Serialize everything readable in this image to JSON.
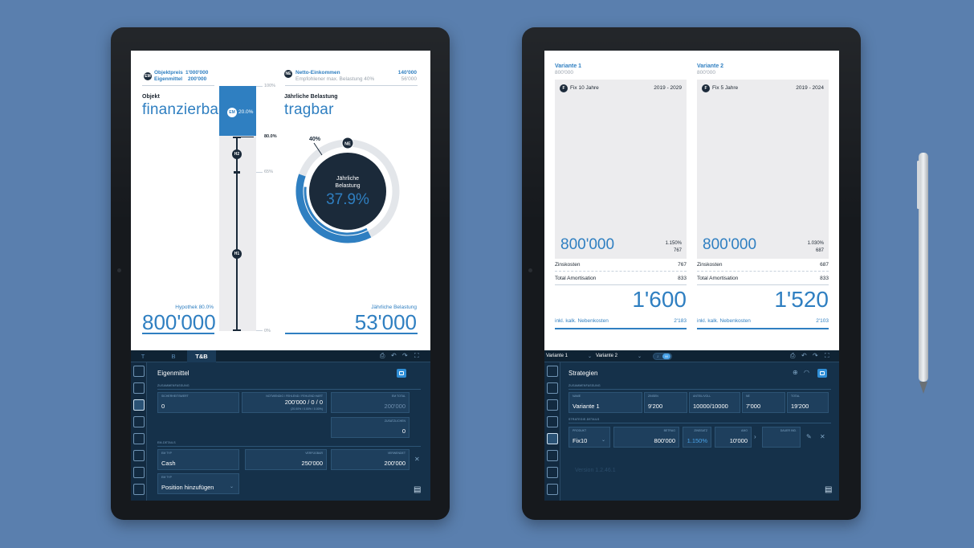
{
  "left": {
    "header": {
      "objektpreis_label": "Objektpreis",
      "objektpreis_value": "1'000'000",
      "eigenmittel_label": "Eigenmittel",
      "eigenmittel_value": "200'000",
      "em_badge": "EM",
      "ne_badge": "NE",
      "netto_label": "Netto-Einkommen",
      "netto_value": "140'000",
      "empf_label": "Empfohlener max. Belastung 40%",
      "empf_value": "56'000"
    },
    "objekt": {
      "label": "Objekt",
      "status": "finanzierbar"
    },
    "belastung": {
      "label": "Jährliche Belastung",
      "status": "tragbar"
    },
    "bar": {
      "top_pct": "100%",
      "em_pct_label": "20.0%",
      "em_badge": "EM",
      "mark_80": "80.0%",
      "mark_65": "65%",
      "bottom_pct": "0%",
      "h2": "H2",
      "h1": "H1"
    },
    "donut": {
      "pct_40": "40%",
      "ne_badge": "NE",
      "center_label_1": "Jährliche",
      "center_label_2": "Belastung",
      "center_value": "37.9%",
      "fraction": 0.379
    },
    "bottom": {
      "hypothek_label": "Hypothek 80.0%",
      "hypothek_value": "800'000",
      "jb_label": "Jährliche Belastung",
      "jb_value": "53'000"
    },
    "app": {
      "tabs": [
        "T",
        "B",
        "T&B"
      ],
      "title": "Eigenmittel",
      "zusammenfassung": "ZUSAMMENFASSUNG",
      "sicherheitswert_cap": "SICHERHEITSWERT",
      "sicherheitswert_val": "0",
      "notwendig_cap": "NOTWENDIG / FEHLEND / FEHLEND HART",
      "notwendig_val": "200'000 / 0 / 0",
      "notwendig_sub": "(20.00% / 0.00% / 0.00%)",
      "em_total_cap": "EM TOTAL",
      "em_total_val": "200'000",
      "zusatz_cap": "ZUSATZLICHEN",
      "zusatz_val": "0",
      "em_details": "EM-DETAILS",
      "em_typ_cap": "EM TYP",
      "em_typ_val": "Cash",
      "verfuegbar_cap": "VERFÜGBAR",
      "verfuegbar_val": "250'000",
      "verwendet_cap": "VERWENDET",
      "verwendet_val": "200'000",
      "em_typ2_cap": "EM TYP",
      "position_val": "Position hinzufügen"
    }
  },
  "right": {
    "variants": [
      {
        "title": "Variante 1",
        "sub": "800'000",
        "badge": "F",
        "fix": "Fix 10 Jahre",
        "years": "2019 - 2029",
        "amount": "800'000",
        "pct": "1.150%",
        "small": "767",
        "zins_label": "Zinskosten",
        "zins_val": "767",
        "amort_label": "Total Amortisation",
        "amort_val": "833",
        "total": "1'600",
        "incl_label": "inkl. kalk. Nebenkosten",
        "incl_val": "2'183"
      },
      {
        "title": "Variante 2",
        "sub": "800'000",
        "badge": "F",
        "fix": "Fix 5 Jahre",
        "years": "2019 - 2024",
        "amount": "800'000",
        "pct": "1.030%",
        "small": "687",
        "zins_label": "Zinskosten",
        "zins_val": "687",
        "amort_label": "Total Amortisation",
        "amort_val": "833",
        "total": "1'520",
        "incl_label": "inkl. kalk. Nebenkosten",
        "incl_val": "2'103"
      }
    ],
    "app": {
      "select1": "Variante 1",
      "select2": "Variante 2",
      "toggle_off": "J",
      "toggle_on": "M",
      "title": "Strategien",
      "zusammenfassung": "ZUSAMMENFASSUNG",
      "name_cap": "NAME",
      "name_val": "Variante 1",
      "zinsen_cap": "ZINSEN",
      "zinsen_val": "9'200",
      "ant_cap": "ANTEIL/VOLL",
      "ant_val": "10000/10000",
      "ne_cap": "NE",
      "ne_val": "7'000",
      "total_cap": "TOTAL",
      "total_val": "19'200",
      "strat_details": "STRATEGIE-DETAILS",
      "produkt_cap": "PRODUKT",
      "produkt_val": "Fix10",
      "betrag_cap": "BETRAG",
      "betrag_val": "800'000",
      "zinssatz_cap": "ZINSSATZ",
      "zinssatz_val": "1.150%",
      "amo_cap": "AMO",
      "amo_val": "10'000",
      "dauer_cap": "DAUER IND.",
      "version": "Version 1.2.46.1"
    }
  },
  "colors": {
    "accent": "#2f7fc1",
    "panel": "#15314a",
    "background": "#5a7fae"
  }
}
